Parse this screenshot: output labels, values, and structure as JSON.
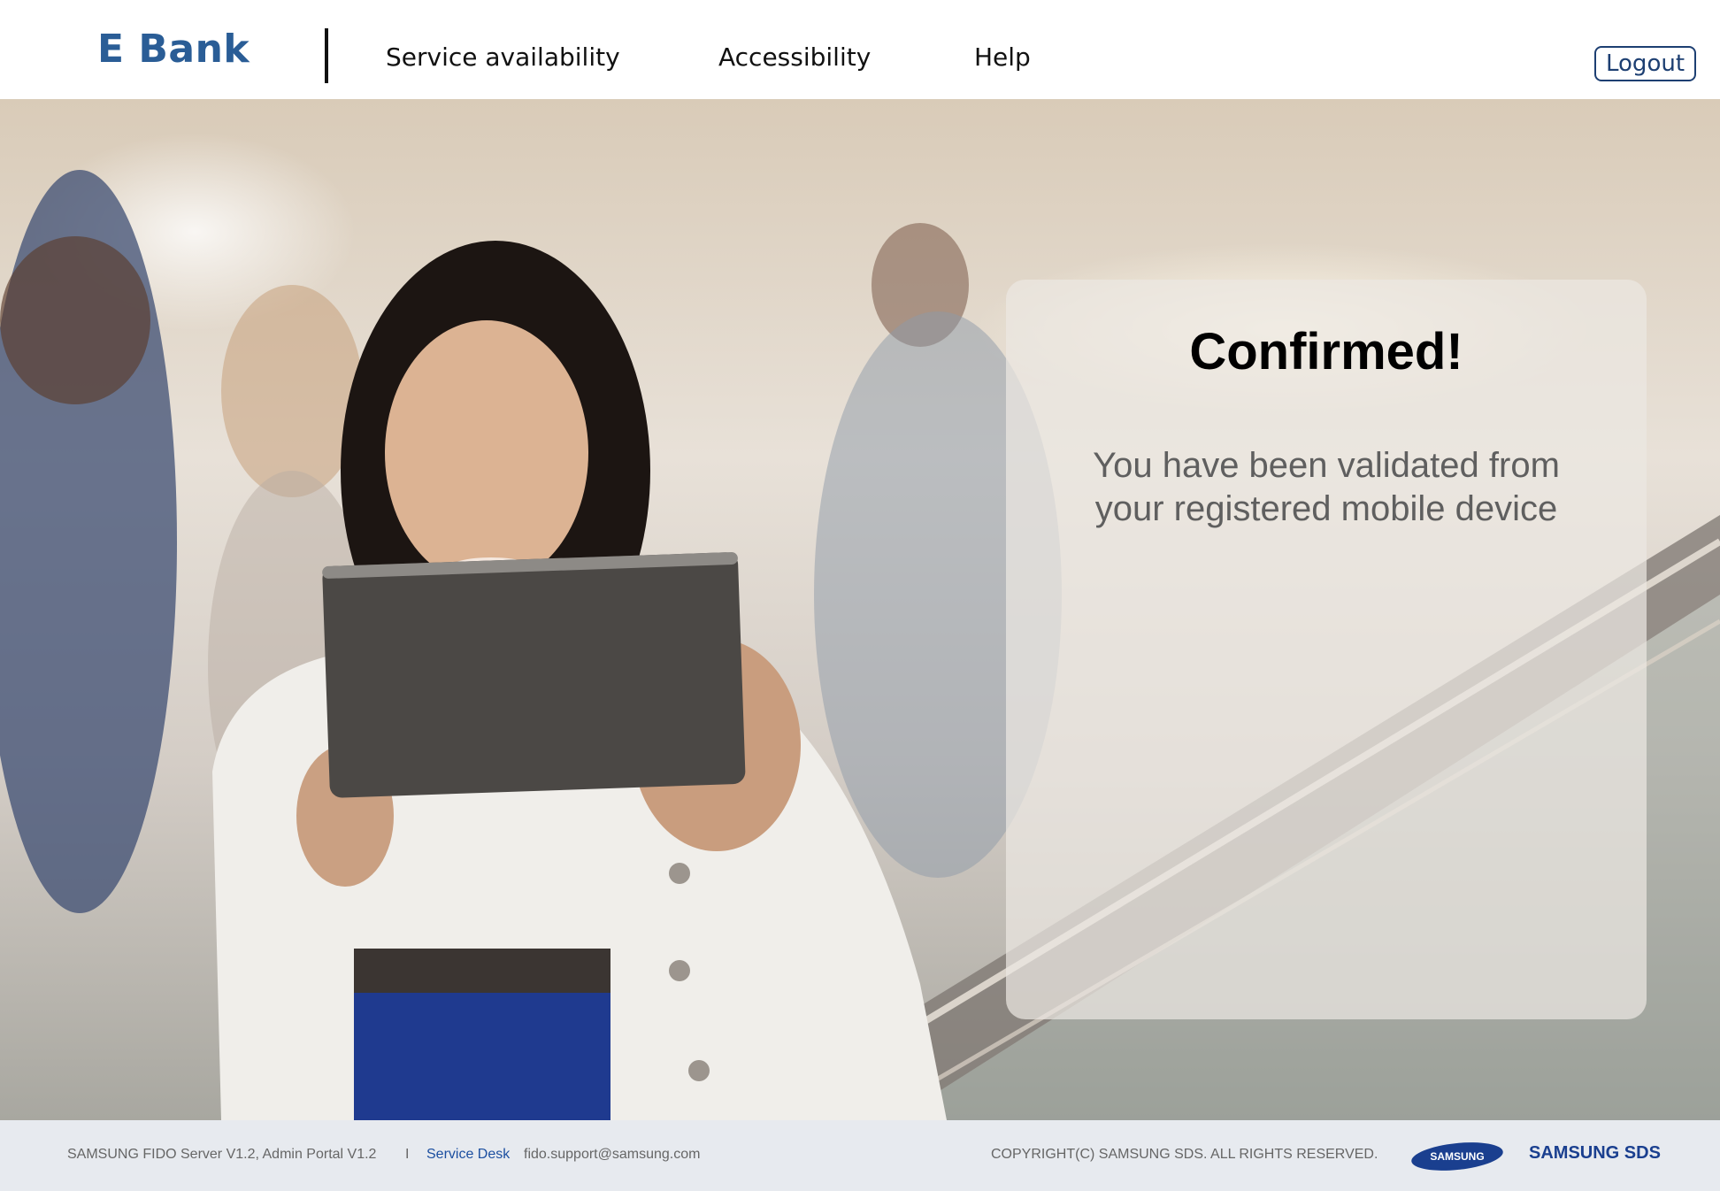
{
  "header": {
    "brand": "E Bank",
    "nav": [
      "Service availability",
      "Accessibility",
      "Help"
    ],
    "logout_label": "Logout"
  },
  "hero": {
    "image_icon": "photo-person-with-tablet-icon"
  },
  "confirmation": {
    "title": "Confirmed!",
    "message": "You have been validated from your registered mobile device"
  },
  "footer": {
    "product": "SAMSUNG FIDO Server V1.2, Admin Portal V1.2",
    "separator": "I",
    "service_desk_label": "Service Desk",
    "support_email": "fido.support@samsung.com",
    "copyright": "COPYRIGHT(C) SAMSUNG SDS. ALL RIGHTS RESERVED.",
    "samsung_logo_text": "SAMSUNG",
    "sds_logo_text": "SAMSUNG SDS"
  },
  "colors": {
    "brand": "#2a5d96",
    "logout_border": "#1d3f72",
    "footer_bg": "#e7eaef",
    "service_desk": "#1c4fa0",
    "samsung_blue": "#1a3f8f"
  }
}
